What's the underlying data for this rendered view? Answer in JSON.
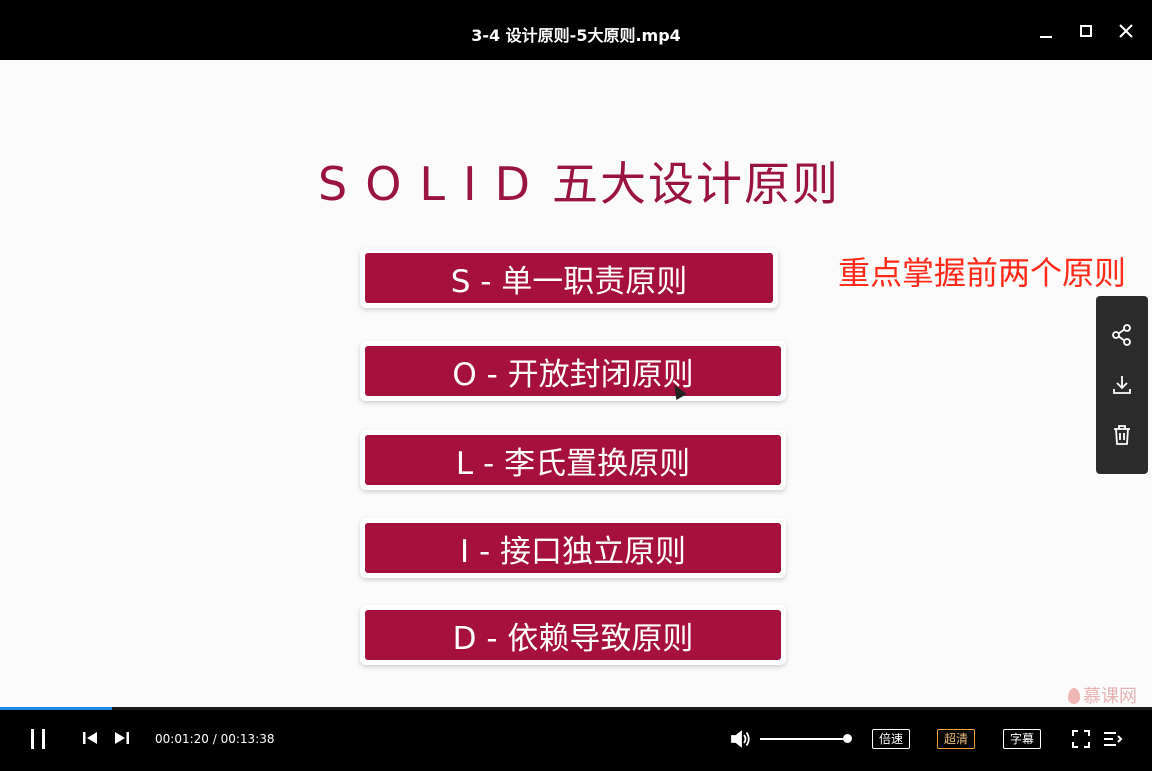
{
  "window": {
    "title": "3-4 设计原则-5大原则.mp4"
  },
  "video": {
    "watermark": "",
    "slide_title_latin": "SOLID",
    "slide_title_cn": "五大设计原则",
    "principles": [
      {
        "label": "S - 单一职责原则"
      },
      {
        "label": "O - 开放封闭原则"
      },
      {
        "label": "L - 李氏置换原则"
      },
      {
        "label": "I - 接口独立原则"
      },
      {
        "label": "D - 依赖导致原则"
      }
    ],
    "annotation": "重点掌握前两个原则",
    "brand": "慕课网"
  },
  "sidebar": {
    "items": [
      {
        "icon": "share-icon"
      },
      {
        "icon": "download-icon"
      },
      {
        "icon": "trash-icon"
      }
    ]
  },
  "player": {
    "progress_fraction": 0.097,
    "current_time": "00:01:20",
    "separator": " / ",
    "total_time": "00:13:38",
    "volume_fraction": 1.0,
    "speed_label": "倍速",
    "quality_label": "超清",
    "subtitle_label": "字幕"
  },
  "colors": {
    "accent": "#a5103d",
    "annotation": "#ff2a1a",
    "progress": "#1e88e5",
    "quality_active": "#f0a030"
  }
}
